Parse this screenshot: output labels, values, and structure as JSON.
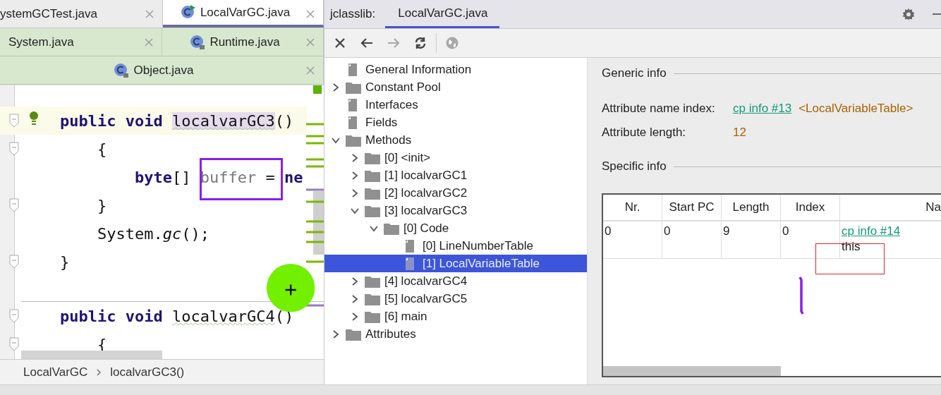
{
  "editor": {
    "tab_rows": [
      [
        {
          "label": "ystemGCTest.java",
          "selected": false,
          "icon": false
        },
        {
          "label": "LocalVarGC.java",
          "selected": true,
          "icon": true
        }
      ],
      [
        {
          "label": "System.java",
          "selected": false,
          "icon": false
        },
        {
          "label": "Runtime.java",
          "selected": false,
          "icon": true
        }
      ],
      [
        {
          "label": "Object.java",
          "selected": false,
          "icon": true
        }
      ]
    ],
    "methods": [
      {
        "lines": [
          {
            "current": true,
            "bulb": true,
            "fold": true,
            "tokens": [
              {
                "text": "public void ",
                "kind": "keyword"
              },
              {
                "text": "localvarGC3",
                "kind": "method",
                "highlighted": true
              },
              {
                "text": "()",
                "kind": "plain"
              }
            ]
          },
          {
            "current": false,
            "bulb": false,
            "fold": true,
            "tokens": [
              {
                "text": "    {",
                "kind": "plain"
              }
            ]
          },
          {
            "current": false,
            "bulb": false,
            "fold": false,
            "tokens": [
              {
                "text": "        byte",
                "kind": "keyword"
              },
              {
                "text": "[] ",
                "kind": "plain"
              },
              {
                "text": "buffer",
                "kind": "unused"
              },
              {
                "text": " = ",
                "kind": "plain"
              },
              {
                "text": "ne",
                "kind": "keyword"
              }
            ]
          },
          {
            "current": false,
            "bulb": false,
            "fold": true,
            "tokens": [
              {
                "text": "    }",
                "kind": "plain"
              }
            ]
          },
          {
            "current": false,
            "bulb": false,
            "fold": false,
            "tokens": [
              {
                "text": "    System.",
                "kind": "plain"
              },
              {
                "text": "gc",
                "kind": "static"
              },
              {
                "text": "();",
                "kind": "plain"
              }
            ]
          },
          {
            "current": false,
            "bulb": false,
            "fold": true,
            "tokens": [
              {
                "text": "}",
                "kind": "plain"
              }
            ]
          }
        ]
      },
      {
        "lines": [
          {
            "current": false,
            "bulb": false,
            "fold": true,
            "tokens": [
              {
                "text": "public void ",
                "kind": "keyword"
              },
              {
                "text": "localvarGC4",
                "kind": "method",
                "highlighted": false
              },
              {
                "text": "()",
                "kind": "plain"
              }
            ]
          },
          {
            "current": false,
            "bulb": false,
            "fold": true,
            "tokens": [
              {
                "text": "    {",
                "kind": "plain"
              }
            ]
          }
        ]
      }
    ],
    "breadcrumb": [
      "LocalVarGC",
      "localvarGC3()"
    ],
    "cursor_highlight": true
  },
  "jclasslib": {
    "title": "jclasslib:",
    "tabs": [
      {
        "label": "LocalVarGC.java",
        "selected": true
      }
    ],
    "toolbar": [
      {
        "kind": "close",
        "disabled": false
      },
      {
        "kind": "back",
        "disabled": false
      },
      {
        "kind": "forward",
        "disabled": true
      },
      {
        "kind": "refresh",
        "disabled": false
      },
      {
        "kind": "browser",
        "disabled": true
      }
    ],
    "tree": [
      {
        "label": "General Information",
        "kind": "file",
        "selected": false
      },
      {
        "label": "Constant Pool",
        "kind": "folder",
        "expanded": false,
        "selected": false
      },
      {
        "label": "Interfaces",
        "kind": "file",
        "selected": false
      },
      {
        "label": "Fields",
        "kind": "file",
        "selected": false
      },
      {
        "label": "Methods",
        "kind": "folder",
        "expanded": true,
        "selected": false,
        "children": [
          {
            "label": "[0] <init>",
            "kind": "folder",
            "expanded": false,
            "selected": false
          },
          {
            "label": "[1] localvarGC1",
            "kind": "folder",
            "expanded": false,
            "selected": false
          },
          {
            "label": "[2] localvarGC2",
            "kind": "folder",
            "expanded": false,
            "selected": false
          },
          {
            "label": "[3] localvarGC3",
            "kind": "folder",
            "expanded": true,
            "selected": false,
            "children": [
              {
                "label": "[0] Code",
                "kind": "folder",
                "expanded": true,
                "selected": false,
                "children": [
                  {
                    "label": "[0] LineNumberTable",
                    "kind": "file",
                    "selected": false
                  },
                  {
                    "label": "[1] LocalVariableTable",
                    "kind": "file",
                    "selected": true
                  }
                ]
              }
            ]
          },
          {
            "label": "[4] localvarGC4",
            "kind": "folder",
            "expanded": false,
            "selected": false
          },
          {
            "label": "[5] localvarGC5",
            "kind": "folder",
            "expanded": false,
            "selected": false
          },
          {
            "label": "[6] main",
            "kind": "folder",
            "expanded": false,
            "selected": false
          }
        ]
      },
      {
        "label": "Attributes",
        "kind": "folder",
        "expanded": false,
        "selected": false
      }
    ],
    "generic_title": "Generic info",
    "fields": [
      {
        "label": "Attribute name index:",
        "link": "cp info #13",
        "value": "<LocalVariableTable>"
      },
      {
        "label": "Attribute length:",
        "value": "12"
      }
    ],
    "specific_title": "Specific info",
    "table": {
      "columns": [
        "Nr.",
        "Start PC",
        "Length",
        "Index",
        "Na"
      ],
      "rows": [
        {
          "cells": [
            "0",
            "0",
            "9",
            "0"
          ],
          "name_link": "cp info #14",
          "name": "this"
        }
      ]
    }
  },
  "annotations": [
    {
      "kind": "box",
      "color": "#8b1fe8"
    },
    {
      "kind": "box",
      "color": "#e3232c"
    },
    {
      "kind": "stroke",
      "color": "#8b1fe8"
    }
  ]
}
